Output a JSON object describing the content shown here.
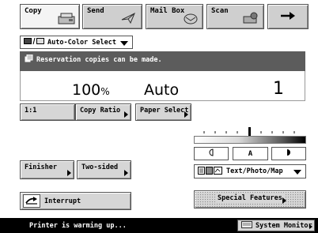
{
  "tabs": [
    {
      "label": "Copy",
      "icon": "copier-icon"
    },
    {
      "label": "Send",
      "icon": "send-icon"
    },
    {
      "label": "Mail Box",
      "icon": "mailbox-icon"
    },
    {
      "label": "Scan",
      "icon": "scanner-icon"
    }
  ],
  "forward_icon": "right-arrow-icon",
  "color_select": {
    "value": "Auto-Color Select"
  },
  "banner": {
    "message": "Reservation copies can be made."
  },
  "readout": {
    "ratio": "100",
    "ratio_unit": "%",
    "paper": "Auto",
    "copies": "1"
  },
  "buttons": {
    "one_to_one": "1:1",
    "copy_ratio": "Copy Ratio",
    "paper_select": "Paper Select",
    "finisher": "Finisher",
    "two_sided": "Two-sided",
    "interrupt": "Interrupt",
    "special_features": "Special Features"
  },
  "density": {
    "lighter_icon": "lighter-icon",
    "auto": "A",
    "darker_icon": "darker-icon",
    "level_fraction": 0.5
  },
  "original_type": {
    "value": "Text/Photo/Map"
  },
  "status": {
    "text": "Printer is warming up...",
    "system_monitor": "System Monitor"
  }
}
